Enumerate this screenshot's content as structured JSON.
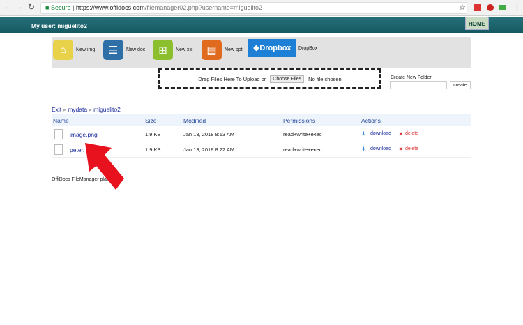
{
  "browser": {
    "secure": "Secure",
    "url_host": "https://www.offidocs.com",
    "url_path": "/filemanager02.php?username=miguelito2"
  },
  "header": {
    "user": "My user: miguelito2",
    "home": "HOME"
  },
  "toolbar": [
    {
      "label": "New img",
      "icon": "image-icon",
      "color": "#e8d24a"
    },
    {
      "label": "New doc",
      "icon": "document-icon",
      "color": "#2f6fa8"
    },
    {
      "label": "New xls",
      "icon": "spreadsheet-icon",
      "color": "#8cbf2e"
    },
    {
      "label": "New ppt",
      "icon": "presentation-icon",
      "color": "#e06a1e"
    }
  ],
  "dropbox": {
    "logo": "Dropbox",
    "label": "DropBox",
    "color": "#1e7fd6"
  },
  "upload": {
    "text": "Drag Files Here To Upload or",
    "button": "Choose Files",
    "status": "No file chosen"
  },
  "folder": {
    "label": "Create New Folder",
    "input_value": "",
    "button": "create"
  },
  "breadcrumb": [
    "Exit",
    "mydata",
    "miguelito2"
  ],
  "columns": [
    "Name",
    "Size",
    "Modified",
    "Permissions",
    "Actions"
  ],
  "rows": [
    {
      "name": "image.png",
      "size": "1.9 KB",
      "modified": "Jan 13, 2018 8:13 AM",
      "permissions": "read+write+exec",
      "download": "download",
      "delete": "delete"
    },
    {
      "name": "peter.",
      "size": "1.9 KB",
      "modified": "Jan 13, 2018 8:22 AM",
      "permissions": "read+write+exec",
      "download": "download",
      "delete": "delete"
    }
  ],
  "footer": "OffiDocs FileManager platf",
  "colors": {
    "header": "#1e6670",
    "arrow": "#e8121e"
  }
}
